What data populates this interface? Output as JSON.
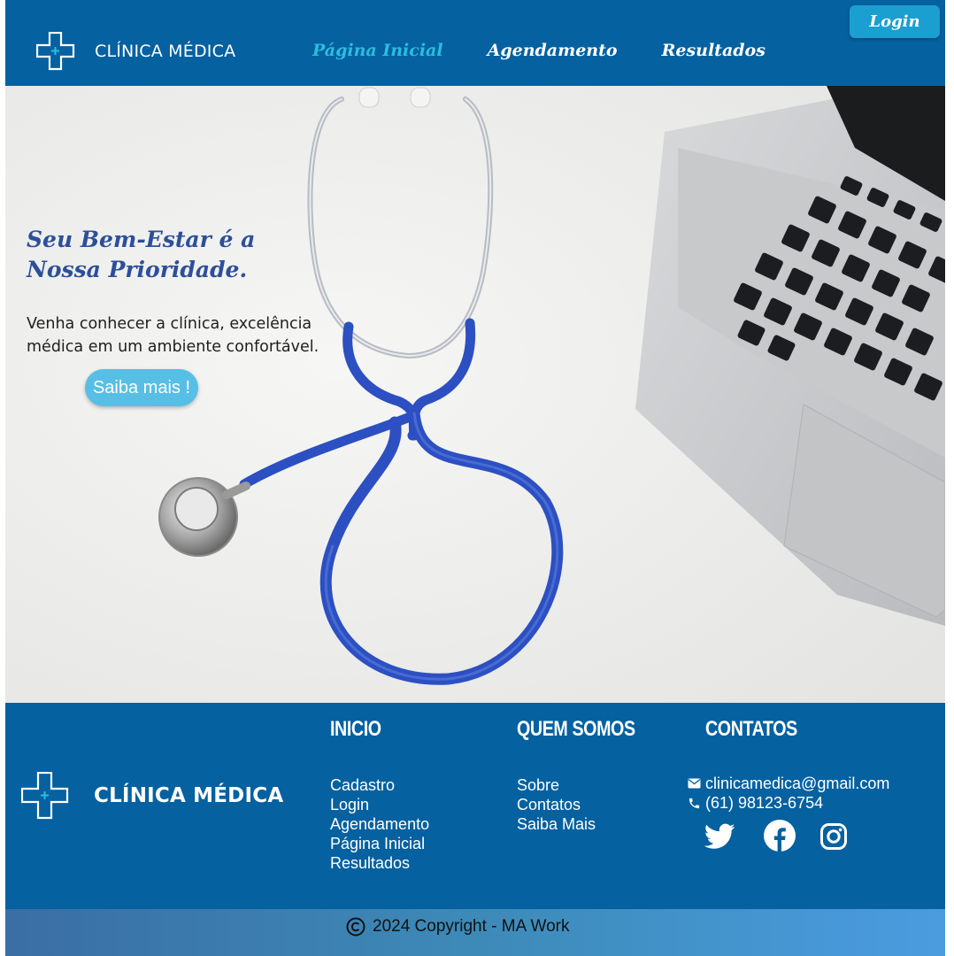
{
  "header": {
    "brand": "CLÍNICA MÉDICA",
    "nav": [
      {
        "label": "Página Inicial",
        "active": true
      },
      {
        "label": "Agendamento",
        "active": false
      },
      {
        "label": "Resultados",
        "active": false
      }
    ],
    "login_label": "Login"
  },
  "hero": {
    "title": "Seu Bem-Estar é a Nossa Prioridade.",
    "text": "Venha conhecer a clínica, excelência médica em um ambiente confortável.",
    "button_label": "Saiba mais !"
  },
  "footer": {
    "brand": "CLÍNICA MÉDICA",
    "columns": [
      {
        "title": "INICIO",
        "items": [
          "Cadastro",
          "Login",
          "Agendamento",
          "Página Inicial",
          "Resultados"
        ]
      },
      {
        "title": "QUEM SOMOS",
        "items": [
          "Sobre",
          "Contatos",
          "Saiba Mais"
        ]
      }
    ],
    "contacts": {
      "title": "CONTATOS",
      "email": "clinicamedica@gmail.com",
      "phone": "(61) 98123-6754",
      "social": [
        "twitter-icon",
        "facebook-icon",
        "instagram-icon"
      ]
    },
    "copyright": "2024 Copyright - MA Work"
  },
  "colors": {
    "primary": "#0561a0",
    "nav_active": "#2bbde0",
    "hero_title": "#2d4f9a",
    "cta": "#57bfe6"
  }
}
